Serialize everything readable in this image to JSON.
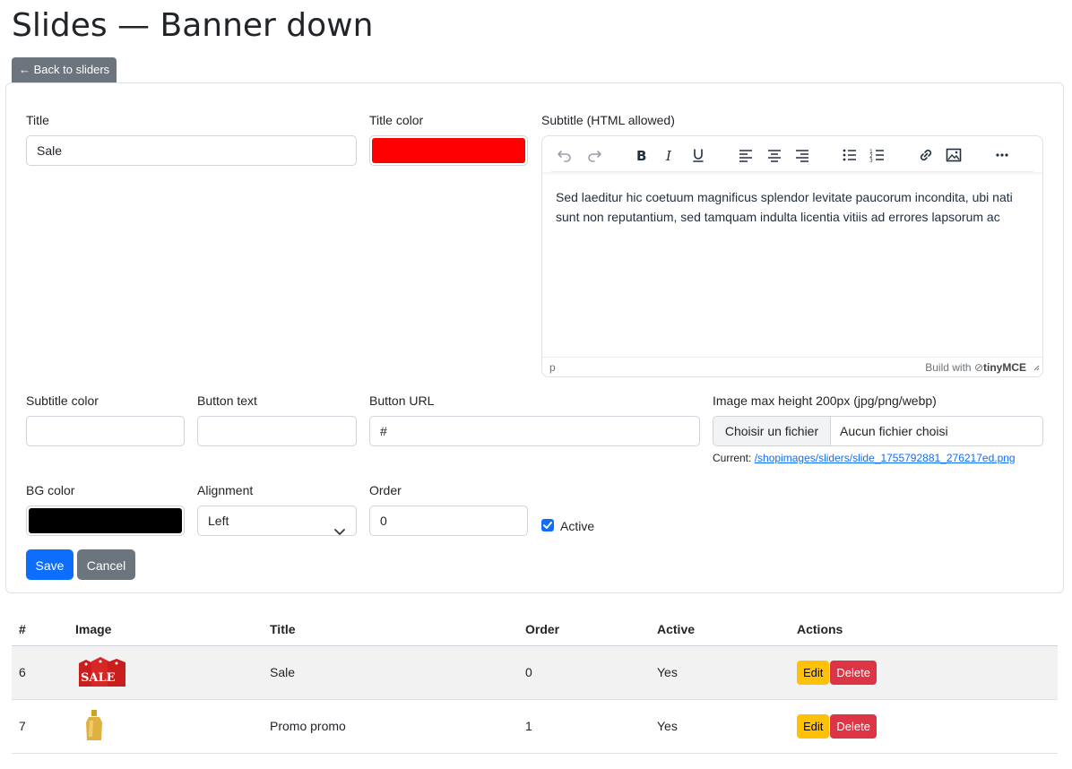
{
  "page": {
    "title": "Slides — Banner down",
    "back_label": "← Back to sliders"
  },
  "form": {
    "title_label": "Title",
    "title_value": "Sale",
    "title_color_label": "Title color",
    "title_color": "#ff0000",
    "subtitle_label": "Subtitle (HTML allowed)",
    "editor": {
      "content": "Sed laeditur hic coetuum magnificus splendor levitate paucorum incondita, ubi nati sunt non reputantium, sed tamquam indulta licentia vitiis ad errores lapsorum ac",
      "status_path": "p",
      "brand_prefix": "Build with",
      "brand_name": "tinyMCE",
      "toolbar_icons": [
        "undo-icon",
        "redo-icon",
        "bold-icon",
        "italic-icon",
        "underline-icon",
        "align-left-icon",
        "align-center-icon",
        "align-right-icon",
        "bullet-list-icon",
        "numbered-list-icon",
        "link-icon",
        "image-icon",
        "more-icon"
      ]
    },
    "subtitle_color_label": "Subtitle color",
    "subtitle_color_value": "",
    "button_text_label": "Button text",
    "button_text_value": "",
    "button_url_label": "Button URL",
    "button_url_value": "#",
    "image_label": "Image max height 200px (jpg/png/webp)",
    "file_button": "Choisir un fichier",
    "file_status": "Aucun fichier choisi",
    "current_label": "Current:",
    "current_link": "/shopimages/sliders/slide_1755792881_276217ed.png",
    "bg_color_label": "BG color",
    "bg_color": "#000000",
    "alignment_label": "Alignment",
    "alignment_value": "Left",
    "order_label": "Order",
    "order_value": "0",
    "active_label": "Active",
    "active_checked": true,
    "save_label": "Save",
    "cancel_label": "Cancel"
  },
  "table": {
    "headers": [
      "#",
      "Image",
      "Title",
      "Order",
      "Active",
      "Actions"
    ],
    "rows": [
      {
        "id": "6",
        "image": "sale-tags-image",
        "title": "Sale",
        "order": "0",
        "active": "Yes",
        "edit": "Edit",
        "delete": "Delete"
      },
      {
        "id": "7",
        "image": "perfume-bottle-image",
        "title": "Promo promo",
        "order": "1",
        "active": "Yes",
        "edit": "Edit",
        "delete": "Delete"
      }
    ]
  },
  "colors": {
    "primary": "#0d6efd",
    "secondary": "#6c757d",
    "warning": "#ffc107",
    "danger": "#dc3545"
  }
}
